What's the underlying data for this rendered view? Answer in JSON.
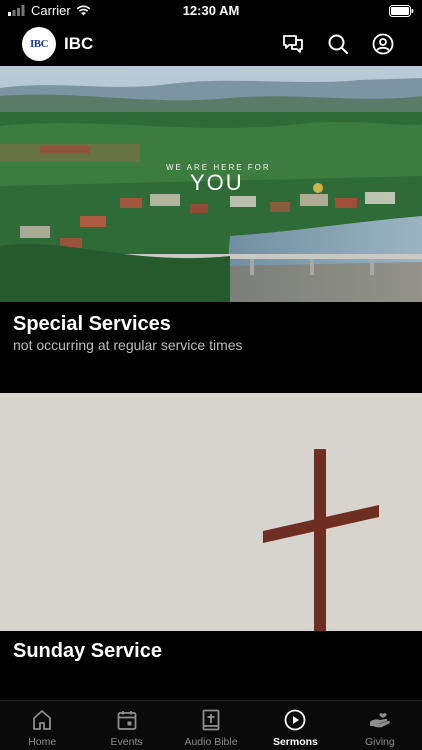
{
  "status_bar": {
    "carrier": "Carrier",
    "time": "12:30 AM"
  },
  "header": {
    "logo_text": "IBC",
    "title": "IBC",
    "icons": [
      "chat-icon",
      "search-icon",
      "profile-icon"
    ]
  },
  "cards": [
    {
      "title": "Special Services",
      "subtitle": "not occurring at regular service times",
      "overlay_small": "WE ARE HERE FOR",
      "overlay_large": "YOU"
    },
    {
      "title": "Sunday Service",
      "subtitle": ""
    }
  ],
  "tabs": [
    {
      "label": "Home",
      "icon": "home-icon",
      "active": false
    },
    {
      "label": "Events",
      "icon": "calendar-icon",
      "active": false
    },
    {
      "label": "Audio Bible",
      "icon": "bible-icon",
      "active": false
    },
    {
      "label": "Sermons",
      "icon": "play-circle-icon",
      "active": true
    },
    {
      "label": "Giving",
      "icon": "giving-hand-icon",
      "active": false
    }
  ]
}
